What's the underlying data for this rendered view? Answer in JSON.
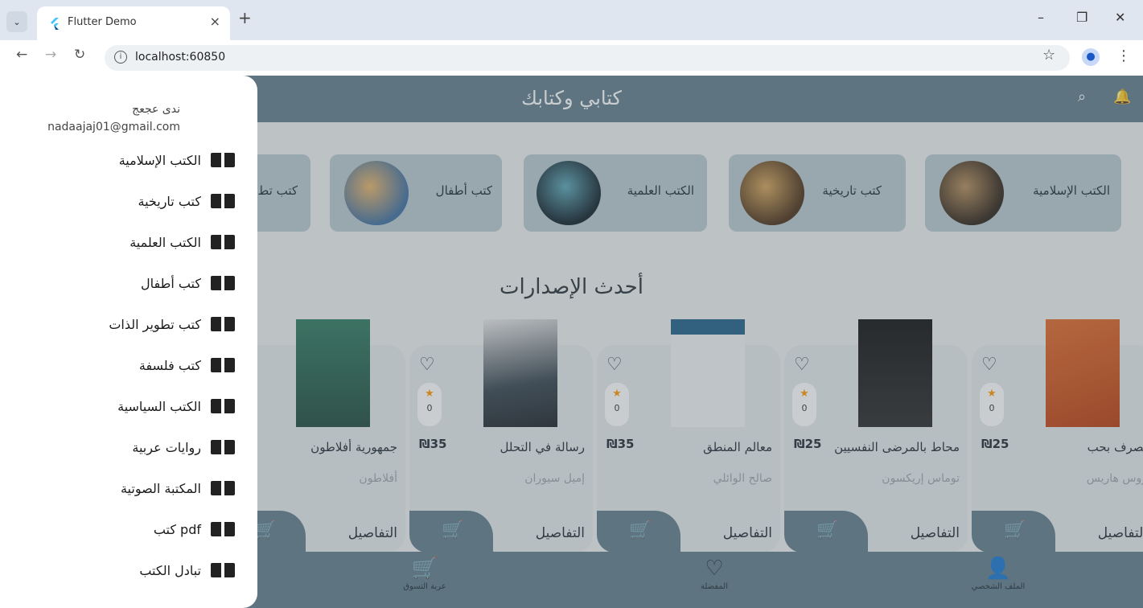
{
  "browser": {
    "tab_title": "Flutter Demo",
    "tab_close": "×",
    "new_tab": "+",
    "url": "localhost:60850",
    "minimize": "–",
    "restore": "❐",
    "close": "✕"
  },
  "app": {
    "title": "كتابي وكتابك",
    "categories": [
      {
        "label": "الكتب الإسلامية"
      },
      {
        "label": "كتب تاريخية"
      },
      {
        "label": "الكتب العلمية"
      },
      {
        "label": "كتب أطفال"
      },
      {
        "label": "كتب تط"
      }
    ],
    "section_title": "أحدث الإصدارات",
    "books": [
      {
        "name": "تصرف بحب",
        "author": "روس هاريس",
        "price": "₪25",
        "rating": "0",
        "details": "التفاصيل",
        "cover_color": "#d9531e"
      },
      {
        "name": "محاط بالمرضى النفسيين",
        "author": "توماس إريكسون",
        "price": "₪25",
        "rating": "0",
        "details": "التفاصيل",
        "cover_color": "#1a1a1a"
      },
      {
        "name": "معالم المنطق",
        "author": "صالح الوائلي",
        "price": "₪35",
        "rating": "0",
        "details": "التفاصيل",
        "cover_color": "#e8edf2"
      },
      {
        "name": "رسالة في التحلل",
        "author": "إميل سيوران",
        "price": "₪35",
        "rating": "0",
        "details": "التفاصيل",
        "cover_color": "#2f3d48"
      },
      {
        "name": "جمهورية أفلاطون",
        "author": "أفلاطون",
        "price": "",
        "rating": "",
        "details": "التفاصيل",
        "cover_color": "#2f6f5a"
      }
    ],
    "bottom_nav": [
      {
        "label": "عربة التسوق",
        "icon": "cart-icon"
      },
      {
        "label": "المفضلة",
        "icon": "heart-icon"
      },
      {
        "label": "الملف الشخصي",
        "icon": "person-icon"
      }
    ]
  },
  "drawer": {
    "user_name": "ندى عجعج",
    "email": "nadaajaj01@gmail.com",
    "items": [
      {
        "label": "الكتب الإسلامية"
      },
      {
        "label": "كتب تاريخية"
      },
      {
        "label": "الكتب العلمية"
      },
      {
        "label": "كتب أطفال"
      },
      {
        "label": "كتب تطوير الذات"
      },
      {
        "label": "كتب فلسفة"
      },
      {
        "label": "الكتب السياسية"
      },
      {
        "label": "روايات عربية"
      },
      {
        "label": "المكتبة الصوتية"
      },
      {
        "label": "كتب pdf"
      },
      {
        "label": "تبادل الكتب"
      }
    ]
  },
  "colors": {
    "primary": "#607d8b",
    "accent_star": "#ff9800",
    "card": "#b7c7ce"
  }
}
